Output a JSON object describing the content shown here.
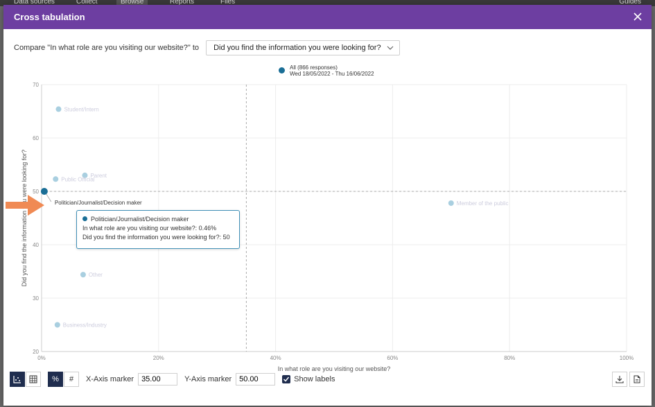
{
  "topnav": {
    "items": [
      "Data sources",
      "Collect",
      "Browse",
      "Reports",
      "Files"
    ],
    "guides": "Guides"
  },
  "dialog": {
    "title": "Cross tabulation",
    "close_icon": "close-icon"
  },
  "compare": {
    "prefix": "Compare \"In what role are you visiting our website?\" to",
    "selected": "Did you find the information you were looking for?"
  },
  "legend": {
    "line1": "All (866 responses)",
    "line2": "Wed 18/05/2022 - Thu 16/06/2022",
    "color": "#1a6e96"
  },
  "chart_data": {
    "type": "scatter",
    "xlabel": "In what role are you visiting our website?",
    "ylabel": "Did you find the information you were looking for?",
    "xlim": [
      0,
      100
    ],
    "ylim": [
      20,
      70
    ],
    "xticks": [
      "0%",
      "20%",
      "40%",
      "60%",
      "80%",
      "100%"
    ],
    "yticks": [
      "20",
      "30",
      "40",
      "50",
      "60",
      "70"
    ],
    "x_marker": 35.0,
    "y_marker": 50.0,
    "points": [
      {
        "x": 2.9,
        "y": 65.4,
        "label": "Student/Intern"
      },
      {
        "x": 7.4,
        "y": 53.0,
        "label": "Parent"
      },
      {
        "x": 2.4,
        "y": 52.3,
        "label": "Public Official"
      },
      {
        "x": 0.46,
        "y": 50.0,
        "label": "Politician/Journalist/Decision maker",
        "highlight": true
      },
      {
        "x": 70.0,
        "y": 47.8,
        "label": "Member of the public"
      },
      {
        "x": 6.5,
        "y": 44.9,
        "label": "Other"
      },
      {
        "x": 7.1,
        "y": 34.4,
        "label": "Other"
      },
      {
        "x": 2.7,
        "y": 25.0,
        "label": "Business/Industry"
      }
    ],
    "highlight_color": "#1a6e96",
    "point_color": "#a9cfe0"
  },
  "highlight_label": "Politician/Journalist/Decision maker",
  "tooltip": {
    "title": "Politician/Journalist/Decision maker",
    "line1": "In what role are you visiting our website?: 0.46%",
    "line2": "Did you find the information you were looking for?: 50"
  },
  "bottom": {
    "percent_symbol": "%",
    "count_symbol": "#",
    "x_marker_label": "X-Axis marker",
    "x_marker_value": "35.00",
    "y_marker_label": "Y-Axis marker",
    "y_marker_value": "50.00",
    "show_labels": "Show labels"
  },
  "colors": {
    "title_bar": "#6d3ea1",
    "accent": "#1f2d4e",
    "arrow": "#f08a54"
  }
}
